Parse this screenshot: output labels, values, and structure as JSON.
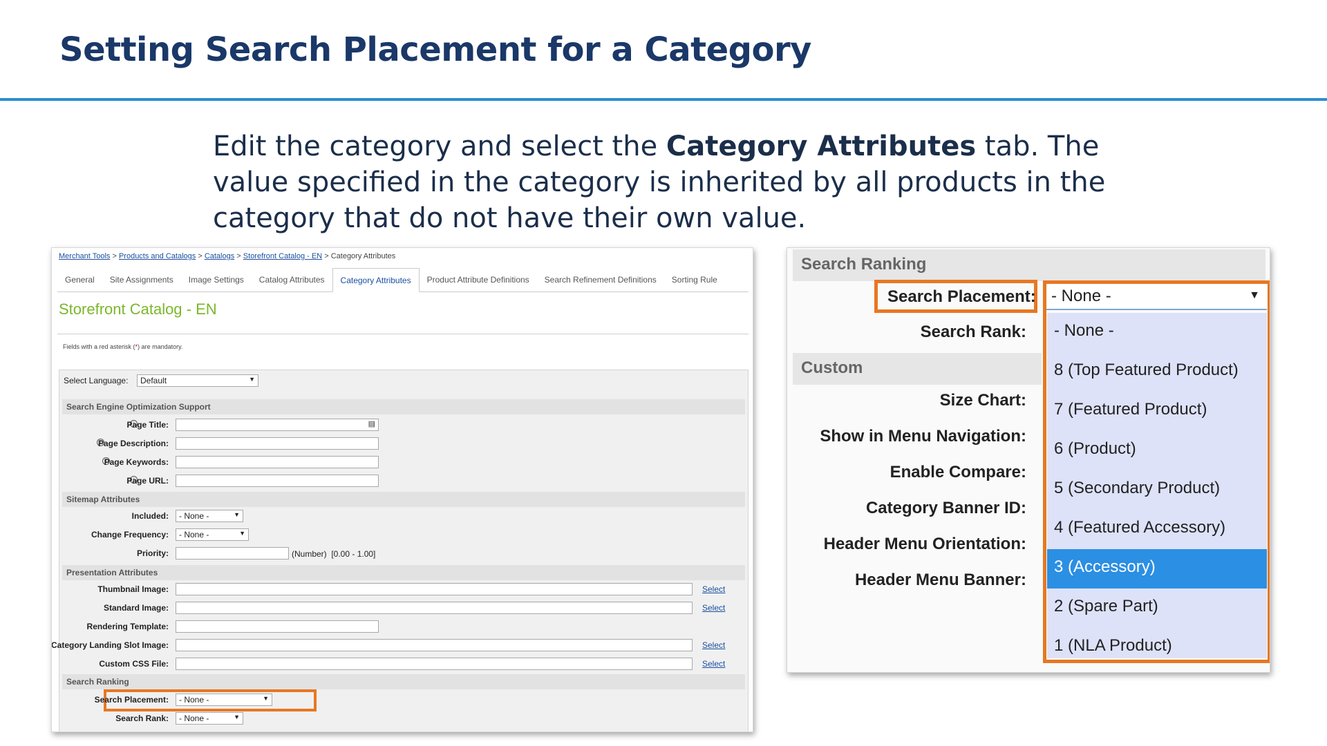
{
  "slide": {
    "title": "Setting Search Placement for a Category",
    "body_part1": "Edit the category and select the ",
    "body_bold": "Category Attributes",
    "body_part2": " tab. The value specified in the category is inherited by all products in the category that do not have their own value."
  },
  "colors": {
    "title": "#1a3868",
    "rule": "#2a8dd4",
    "highlight_box": "#e87722",
    "selected_option": "#2b8fe3",
    "catalog_heading": "#7bb72a"
  },
  "breadcrumb": {
    "items": [
      "Merchant Tools",
      "Products and Catalogs",
      "Catalogs",
      "Storefront Catalog - EN"
    ],
    "separator": ">",
    "current": "Category Attributes"
  },
  "tabs": [
    "General",
    "Site Assignments",
    "Image Settings",
    "Catalog Attributes",
    "Category Attributes",
    "Product Attribute Definitions",
    "Search Refinement Definitions",
    "Sorting Rule"
  ],
  "catalog_heading": "Storefront Catalog - EN",
  "mandatory_note": {
    "before": "Fields with a red asterisk (",
    "asterisk": "*",
    "after": ") are mandatory."
  },
  "language": {
    "label": "Select Language:",
    "value": "Default"
  },
  "sections": {
    "seo": "Search Engine Optimization Support",
    "sitemap": "Sitemap Attributes",
    "presentation": "Presentation Attributes",
    "search_ranking": "Search Ranking"
  },
  "fields": {
    "page_title": "Page Title:",
    "page_description": "Page Description:",
    "page_keywords": "Page Keywords:",
    "page_url": "Page URL:",
    "included": "Included:",
    "change_frequency": "Change Frequency:",
    "priority": "Priority:",
    "thumbnail_image": "Thumbnail Image:",
    "standard_image": "Standard Image:",
    "rendering_template": "Rendering Template:",
    "landing_slot_image": "Category Landing Slot Image:",
    "custom_css": "Custom CSS File:",
    "search_placement": "Search Placement:",
    "search_rank": "Search Rank:"
  },
  "none_value": "- None -",
  "priority_hint": {
    "type": "(Number)",
    "range": "[0.00 - 1.00]"
  },
  "select_link": "Select",
  "zoom": {
    "search_ranking": "Search Ranking",
    "search_placement": "Search Placement:",
    "search_rank": "Search Rank:",
    "custom": "Custom",
    "custom_fields": [
      "Size Chart:",
      "Show in Menu Navigation:",
      "Enable Compare:",
      "Category Banner ID:",
      "Header Menu Orientation:",
      "Header Menu Banner:"
    ],
    "select_value": "- None -",
    "options": [
      "- None -",
      "8 (Top Featured Product)",
      "7 (Featured Product)",
      "6 (Product)",
      "5 (Secondary Product)",
      "4 (Featured Accessory)",
      "3 (Accessory)",
      "2 (Spare Part)",
      "1 (NLA Product)"
    ],
    "highlighted_option": "3 (Accessory)"
  }
}
